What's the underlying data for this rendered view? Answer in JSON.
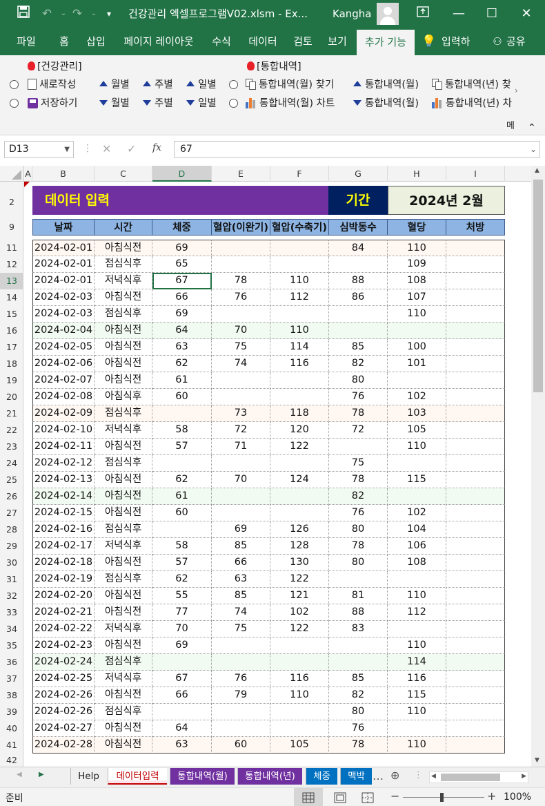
{
  "title_bar": {
    "file_title": "건강관리 엑셀프로그램V02.xlsm  -  Ex...",
    "user_name": "Kangha",
    "icons": [
      "save-icon",
      "undo-icon",
      "redo-icon",
      "customize-qat-icon",
      "ribbon-display-icon",
      "minimize-icon",
      "restore-icon",
      "close-icon"
    ]
  },
  "ribbon_tabs": [
    "파일",
    "홈",
    "삽입",
    "페이지 레이아웃",
    "수식",
    "데이터",
    "검토",
    "보기",
    "추가 기능"
  ],
  "ribbon_tab_active": "추가 기능",
  "tell_me": "입력하",
  "share": "공유",
  "ribbon": {
    "group1_title": "[건강관리]",
    "group2_title": "[통합내역]",
    "new_label": "새로작성",
    "save_label": "저장하기",
    "monthly": "월별",
    "weekly": "주별",
    "daily": "일별",
    "find_monthly": "통합내역(월) 찾기",
    "chart_monthly": "통합내역(월) 차트",
    "summary_monthly": "통합내역(월)",
    "summary_yearly": "통합내역(년) 찾",
    "summary_yearly2": "통합내역(년) 차",
    "more": "메"
  },
  "formula_bar": {
    "name_box": "D13",
    "formula": "67",
    "fx": "fx"
  },
  "columns": [
    "A",
    "B",
    "C",
    "D",
    "E",
    "F",
    "G",
    "H",
    "I"
  ],
  "selected_column": "D",
  "rows": [
    "2",
    "9",
    "11",
    "12",
    "13",
    "14",
    "15",
    "16",
    "17",
    "18",
    "19",
    "20",
    "21",
    "22",
    "23",
    "24",
    "25",
    "26",
    "27",
    "28",
    "29",
    "30",
    "31",
    "32",
    "33",
    "34",
    "35",
    "36",
    "37",
    "38",
    "39",
    "40",
    "41",
    "42"
  ],
  "selected_row": "13",
  "sheet": {
    "banner_title": "데이터 입력",
    "period_label": "기간",
    "period_value": "2024년 2월",
    "headers": [
      "날짜",
      "시간",
      "체중",
      "혈압(이완기)",
      "혈압(수축기)",
      "심박동수",
      "혈당",
      "처방"
    ],
    "data": [
      [
        "2024-02-01",
        "아침식전",
        "69",
        "",
        "",
        "84",
        "110",
        ""
      ],
      [
        "2024-02-01",
        "점심식후",
        "65",
        "",
        "",
        "",
        "109",
        ""
      ],
      [
        "2024-02-01",
        "저녁식후",
        "67",
        "78",
        "110",
        "88",
        "108",
        ""
      ],
      [
        "2024-02-03",
        "아침식전",
        "66",
        "76",
        "112",
        "86",
        "107",
        ""
      ],
      [
        "2024-02-03",
        "점심식후",
        "69",
        "",
        "",
        "",
        "110",
        ""
      ],
      [
        "2024-02-04",
        "아침식전",
        "64",
        "70",
        "110",
        "",
        "",
        ""
      ],
      [
        "2024-02-05",
        "아침식전",
        "63",
        "75",
        "114",
        "85",
        "100",
        ""
      ],
      [
        "2024-02-06",
        "아침식전",
        "62",
        "74",
        "116",
        "82",
        "101",
        ""
      ],
      [
        "2024-02-07",
        "아침식전",
        "61",
        "",
        "",
        "80",
        "",
        ""
      ],
      [
        "2024-02-08",
        "아침식후",
        "60",
        "",
        "",
        "76",
        "102",
        ""
      ],
      [
        "2024-02-09",
        "점심식후",
        "",
        "73",
        "118",
        "78",
        "103",
        ""
      ],
      [
        "2024-02-10",
        "저녁식후",
        "58",
        "72",
        "120",
        "72",
        "105",
        ""
      ],
      [
        "2024-02-11",
        "아침식전",
        "57",
        "71",
        "122",
        "",
        "110",
        ""
      ],
      [
        "2024-02-12",
        "점심식후",
        "",
        "",
        "",
        "75",
        "",
        ""
      ],
      [
        "2024-02-13",
        "아침식전",
        "62",
        "70",
        "124",
        "78",
        "115",
        ""
      ],
      [
        "2024-02-14",
        "아침식전",
        "61",
        "",
        "",
        "82",
        "",
        ""
      ],
      [
        "2024-02-15",
        "아침식전",
        "60",
        "",
        "",
        "76",
        "102",
        ""
      ],
      [
        "2024-02-16",
        "점심식후",
        "",
        "69",
        "126",
        "80",
        "104",
        ""
      ],
      [
        "2024-02-17",
        "저녁식후",
        "58",
        "85",
        "128",
        "78",
        "106",
        ""
      ],
      [
        "2024-02-18",
        "아침식전",
        "57",
        "66",
        "130",
        "80",
        "108",
        ""
      ],
      [
        "2024-02-19",
        "점심식후",
        "62",
        "63",
        "122",
        "",
        "",
        ""
      ],
      [
        "2024-02-20",
        "아침식전",
        "55",
        "85",
        "121",
        "81",
        "110",
        ""
      ],
      [
        "2024-02-21",
        "아침식전",
        "77",
        "74",
        "102",
        "88",
        "112",
        ""
      ],
      [
        "2024-02-22",
        "저녁식후",
        "70",
        "75",
        "122",
        "83",
        "",
        ""
      ],
      [
        "2024-02-23",
        "아침식전",
        "69",
        "",
        "",
        "",
        "110",
        ""
      ],
      [
        "2024-02-24",
        "점심식후",
        "",
        "",
        "",
        "",
        "114",
        ""
      ],
      [
        "2024-02-25",
        "저녁식후",
        "67",
        "76",
        "116",
        "85",
        "116",
        ""
      ],
      [
        "2024-02-26",
        "아침식전",
        "66",
        "79",
        "110",
        "82",
        "115",
        ""
      ],
      [
        "2024-02-26",
        "점심식후",
        "",
        "",
        "",
        "80",
        "110",
        ""
      ],
      [
        "2024-02-27",
        "아침식전",
        "64",
        "",
        "",
        "76",
        "",
        ""
      ],
      [
        "2024-02-28",
        "아침식전",
        "63",
        "60",
        "105",
        "78",
        "110",
        ""
      ]
    ],
    "row_tints": [
      "#fff7f2",
      "#ffffff",
      "#ffffff",
      "#ffffff",
      "#ffffff",
      "#f2fbf1",
      "#ffffff",
      "#ffffff",
      "#ffffff",
      "#ffffff",
      "#fff7f2",
      "#ffffff",
      "#ffffff",
      "#ffffff",
      "#ffffff",
      "#f2fbf1",
      "#ffffff",
      "#ffffff",
      "#ffffff",
      "#ffffff",
      "#ffffff",
      "#ffffff",
      "#ffffff",
      "#ffffff",
      "#ffffff",
      "#f2fbf1",
      "#ffffff",
      "#ffffff",
      "#ffffff",
      "#ffffff",
      "#fff7f2"
    ]
  },
  "sheet_tabs": [
    {
      "label": "Help",
      "bg": "#f0f0f0",
      "fg": "#222"
    },
    {
      "label": "데이터입력",
      "bg": "#ffe4ec",
      "fg": "#c00000"
    },
    {
      "label": "통합내역(월)",
      "bg": "#7030a0",
      "fg": "#ffffff"
    },
    {
      "label": "통합내역(년)",
      "bg": "#7030a0",
      "fg": "#ffffff"
    },
    {
      "label": "체중",
      "bg": "#0070c0",
      "fg": "#ffffff"
    },
    {
      "label": "맥박",
      "bg": "#0070c0",
      "fg": "#ffffff"
    }
  ],
  "status": {
    "mode": "준비",
    "zoom": "100%"
  },
  "colors": {
    "excel_green": "#217346",
    "banner_purple": "#7030a0",
    "banner_yellow": "#ffff00",
    "period_bg": "#002060",
    "period_value_bg": "#ebf1de",
    "header_blue": "#8db4e2"
  }
}
